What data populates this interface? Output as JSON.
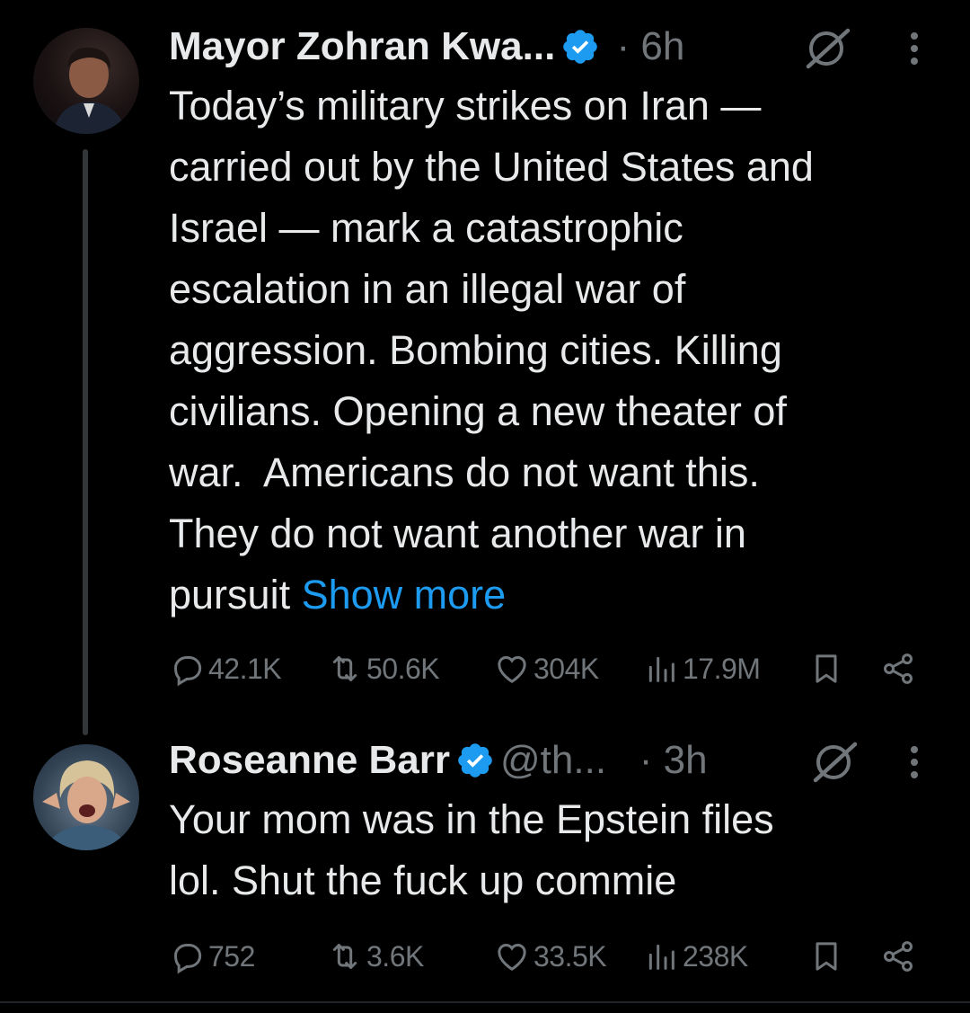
{
  "tweets": [
    {
      "name": "Mayor Zohran Kwa...",
      "handle": "",
      "time": "6h",
      "text_lines": [
        "Today’s military strikes on Iran —",
        "carried out by the United States and",
        "Israel — mark a catastrophic",
        "escalation in an illegal war of",
        "aggression. Bombing cities. Killing",
        "civilians. Opening a new theater of",
        "war.  Americans do not want this.",
        "They do not want another war in",
        "pursuit "
      ],
      "show_more": "Show more",
      "replies": "42.1K",
      "reposts": "50.6K",
      "likes": "304K",
      "views": "17.9M"
    },
    {
      "name": "Roseanne Barr",
      "handle": "@th...",
      "time": "3h",
      "text_lines": [
        "Your mom was in the Epstein files",
        "lol. Shut the fuck up commie"
      ],
      "replies": "752",
      "reposts": "3.6K",
      "likes": "33.5K",
      "views": "238K"
    }
  ],
  "colors": {
    "background": "#000000",
    "text": "#e7e9ea",
    "muted": "#71767b",
    "link": "#1d9bf0",
    "verified": "#1d9bf0"
  },
  "icons": {
    "reply": "speech-bubble-icon",
    "repost": "repost-icon",
    "like": "heart-icon",
    "views": "bar-chart-icon",
    "bookmark": "bookmark-icon",
    "share": "share-icon",
    "grok": "grok-icon",
    "more": "more-vertical-icon",
    "verified": "verified-badge-icon"
  }
}
